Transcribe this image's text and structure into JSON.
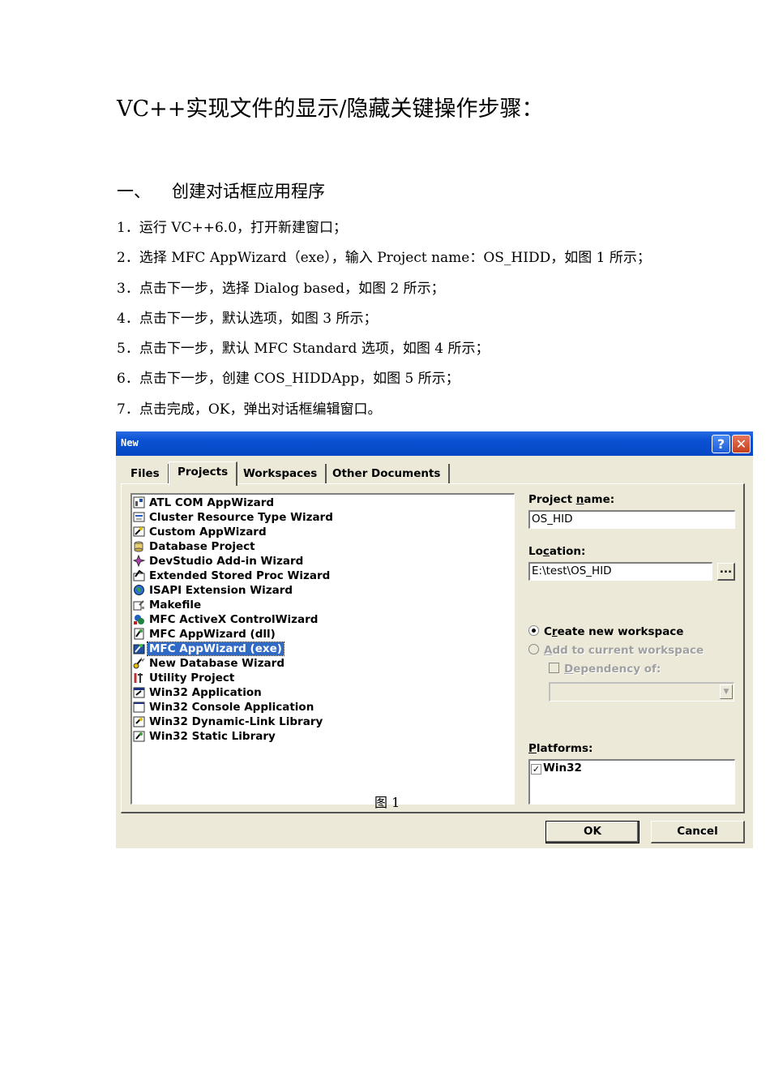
{
  "doc": {
    "title": "VC++实现文件的显示/隐藏关键操作步骤：",
    "section_num": "一、",
    "section_title": "创建对话框应用程序",
    "steps": [
      "1．运行 VC++6.0，打开新建窗口；",
      "2．选择 MFC AppWizard（exe），输入 Project name：OS_HIDD，如图 1 所示；",
      "3．点击下一步，选择 Dialog based，如图 2 所示；",
      "4．点击下一步，默认选项，如图 3 所示；",
      "5．点击下一步，默认 MFC Standard 选项，如图 4 所示；",
      "6．点击下一步，创建 COS_HIDDApp，如图 5 所示；",
      "7．点击完成，OK，弹出对话框编辑窗口。"
    ],
    "figure_caption": "图 1"
  },
  "dialog": {
    "title": "New",
    "help_glyph": "?",
    "close_glyph": "✕",
    "tabs": [
      "Files",
      "Projects",
      "Workspaces",
      "Other Documents"
    ],
    "active_tab": "Projects",
    "project_types": [
      {
        "label": "ATL COM AppWizard",
        "icon": "atl-icon"
      },
      {
        "label": "Cluster Resource Type Wizard",
        "icon": "cluster-icon"
      },
      {
        "label": "Custom AppWizard",
        "icon": "custom-wizard-icon"
      },
      {
        "label": "Database Project",
        "icon": "database-icon"
      },
      {
        "label": "DevStudio Add-in Wizard",
        "icon": "addin-icon"
      },
      {
        "label": "Extended Stored Proc Wizard",
        "icon": "stored-proc-icon"
      },
      {
        "label": "ISAPI Extension Wizard",
        "icon": "globe-icon"
      },
      {
        "label": "Makefile",
        "icon": "makefile-icon"
      },
      {
        "label": "MFC ActiveX ControlWizard",
        "icon": "activex-icon"
      },
      {
        "label": "MFC AppWizard (dll)",
        "icon": "mfc-dll-icon"
      },
      {
        "label": "MFC AppWizard (exe)",
        "icon": "mfc-exe-icon"
      },
      {
        "label": "New Database Wizard",
        "icon": "new-db-icon"
      },
      {
        "label": "Utility Project",
        "icon": "utility-icon"
      },
      {
        "label": "Win32 Application",
        "icon": "win32-app-icon"
      },
      {
        "label": "Win32 Console Application",
        "icon": "console-icon"
      },
      {
        "label": "Win32 Dynamic-Link Library",
        "icon": "dll-icon"
      },
      {
        "label": "Win32 Static Library",
        "icon": "lib-icon"
      }
    ],
    "selected_project": "MFC AppWizard (exe)",
    "project_name_label_pre": "Project ",
    "project_name_label_ul": "n",
    "project_name_label_post": "ame:",
    "project_name_value": "OS_HID",
    "location_label_pre": "Lo",
    "location_label_ul": "c",
    "location_label_post": "ation:",
    "location_value": "E:\\test\\OS_HID",
    "browse_label": "...",
    "create_ws_pre": "C",
    "create_ws_ul": "r",
    "create_ws_post": "eate new workspace",
    "add_ws_ul": "A",
    "add_ws_post": "dd to current workspace",
    "dependency_ul": "D",
    "dependency_post": "ependency of:",
    "platforms_ul": "P",
    "platforms_post": "latforms:",
    "platforms": [
      {
        "label": "Win32",
        "checked": true
      }
    ],
    "check_glyph": "✓",
    "combo_arrow": "▼",
    "ok_label": "OK",
    "cancel_label": "Cancel"
  }
}
